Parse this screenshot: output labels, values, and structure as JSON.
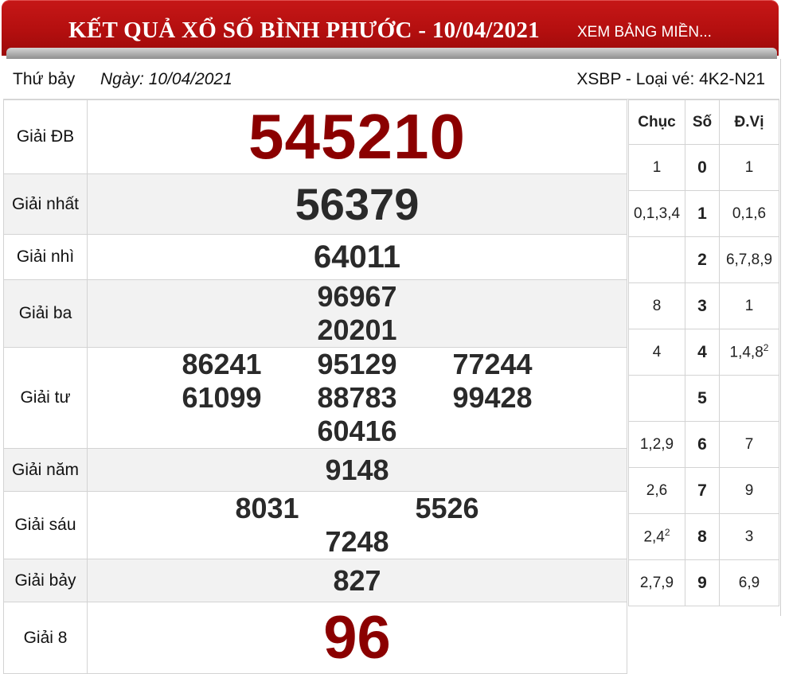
{
  "header": {
    "title": "KẾT QUẢ XỔ SỐ BÌNH PHƯỚC - 10/04/2021",
    "link": "XEM BẢNG MIỀN..."
  },
  "info": {
    "day": "Thứ bảy",
    "date": "Ngày: 10/04/2021",
    "ticket": "XSBP - Loại vé: 4K2-N21"
  },
  "prizes": {
    "db": {
      "label": "Giải ĐB",
      "numbers": [
        "545210"
      ]
    },
    "g1": {
      "label": "Giải nhất",
      "numbers": [
        "56379"
      ]
    },
    "g2": {
      "label": "Giải nhì",
      "numbers": [
        "64011"
      ]
    },
    "g3": {
      "label": "Giải ba",
      "numbers": [
        "96967",
        "20201"
      ]
    },
    "g4": {
      "label": "Giải tư",
      "numbers": [
        "86241",
        "95129",
        "77244",
        "61099",
        "88783",
        "99428",
        "60416"
      ]
    },
    "g5": {
      "label": "Giải năm",
      "numbers": [
        "9148"
      ]
    },
    "g6": {
      "label": "Giải sáu",
      "numbers": [
        "8031",
        "5526",
        "7248"
      ]
    },
    "g7": {
      "label": "Giải bảy",
      "numbers": [
        "827"
      ]
    },
    "g8": {
      "label": "Giải 8",
      "numbers": [
        "96"
      ]
    }
  },
  "loto": {
    "headers": {
      "chuc": "Chục",
      "so": "Số",
      "dvi": "Đ.Vị"
    },
    "rows": [
      {
        "chuc": "1",
        "so": "0",
        "dvi": "1"
      },
      {
        "chuc": "0,1,3,4",
        "so": "1",
        "dvi": "0,1,6"
      },
      {
        "chuc": "",
        "so": "2",
        "dvi": "6,7,8,9"
      },
      {
        "chuc": "8",
        "so": "3",
        "dvi": "1"
      },
      {
        "chuc": "4",
        "so": "4",
        "dvi": "1,4,8",
        "dvi_sup": "2"
      },
      {
        "chuc": "",
        "so": "5",
        "dvi": ""
      },
      {
        "chuc": "1,2,9",
        "so": "6",
        "dvi": "7"
      },
      {
        "chuc": "2,6",
        "so": "7",
        "dvi": "9"
      },
      {
        "chuc": "2,4",
        "chuc_sup": "2",
        "so": "8",
        "dvi": "3"
      },
      {
        "chuc": "2,7,9",
        "so": "9",
        "dvi": "6,9"
      }
    ]
  },
  "colors": {
    "header_red": "#b40f0f",
    "special_number": "#8b0000",
    "number": "#2a2a2a"
  }
}
